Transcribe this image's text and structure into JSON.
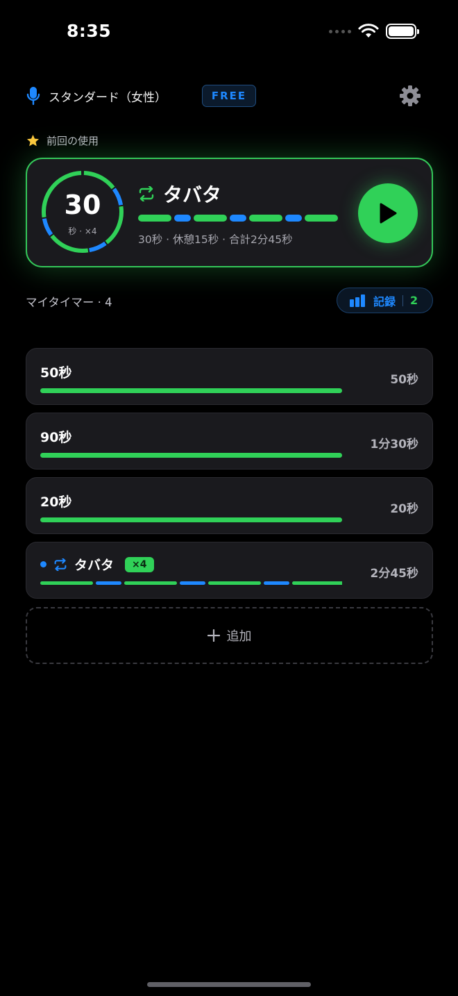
{
  "status": {
    "time": "8:35"
  },
  "header": {
    "voice_label": "スタンダード（女性）",
    "plan_badge": "FREE"
  },
  "last_used": {
    "label": "前回の使用",
    "ring_value": "30",
    "ring_sub": "秒 · ×4",
    "title": "タバタ",
    "description": "30秒 · 休憩15秒 · 合計2分45秒"
  },
  "my_timers": {
    "label": "マイタイマー · 4",
    "history_label": "記録",
    "history_count": "2"
  },
  "timers": [
    {
      "title": "50秒",
      "duration": "50秒"
    },
    {
      "title": "90秒",
      "duration": "1分30秒"
    },
    {
      "title": "20秒",
      "duration": "20秒"
    },
    {
      "title": "タバタ",
      "badge": "×4",
      "duration": "2分45秒"
    }
  ],
  "add_label": "追加",
  "colors": {
    "work": "#30d158",
    "rest": "#1e88ff",
    "accent": "#34c759"
  }
}
